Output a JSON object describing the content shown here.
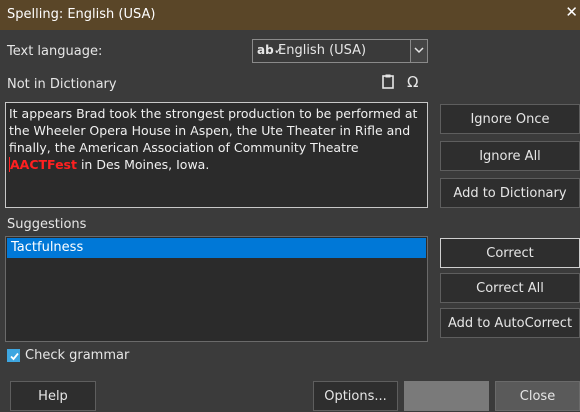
{
  "window": {
    "title": "Spelling: English (USA)",
    "close_glyph": "✕"
  },
  "text_language": {
    "label": "Text language:",
    "value": "English (USA)",
    "icon": "spellcheck-ab-icon"
  },
  "not_in_dictionary": {
    "label": "Not in Dictionary",
    "text_before": "It appears Brad took the strongest production to be performed at the Wheeler Opera House in Aspen, the Ute Theater in Rifle and finally, the American Association of Community Theatre ",
    "flagged_word": "AACTFest",
    "text_after": " in Des Moines, Iowa.",
    "flag_color": "#ff2020"
  },
  "icons": {
    "clipboard": "clipboard-icon",
    "special_char": "Ω"
  },
  "suggestions": {
    "label": "Suggestions",
    "items": [
      "Tactfulness"
    ],
    "selected_color": "#0078d7"
  },
  "buttons": {
    "ignore_once": "Ignore Once",
    "ignore_all": "Ignore All",
    "add_to_dictionary": "Add to Dictionary",
    "correct": "Correct",
    "correct_all": "Correct All",
    "add_to_autocorrect": "Add to AutoCorrect",
    "help": "Help",
    "options": "Options...",
    "close": "Close"
  },
  "check_grammar": {
    "label": "Check grammar",
    "checked": true
  },
  "colors": {
    "title_bar": "#5a4628",
    "background": "#3b3b3b",
    "accent": "#3ea6e0"
  }
}
